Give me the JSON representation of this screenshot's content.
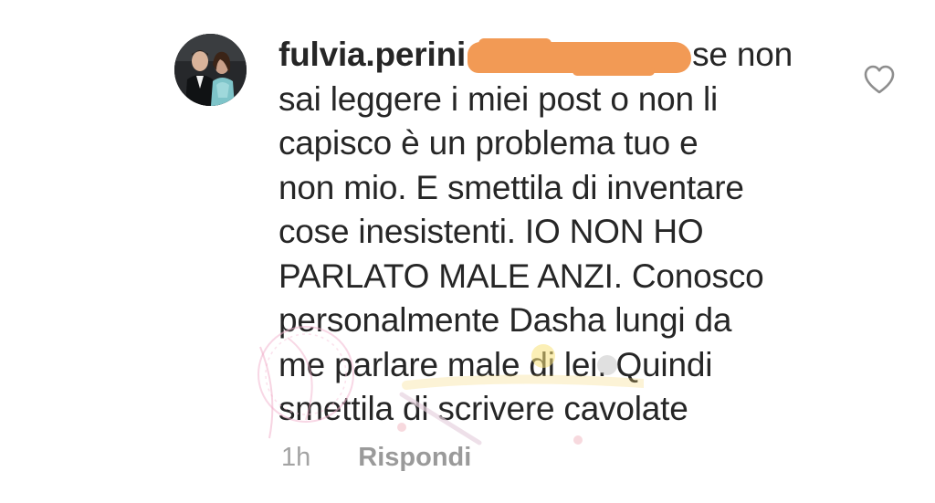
{
  "comment": {
    "username": "fulvia.perini",
    "lines": [
      "se non",
      "sai leggere i miei post o non li",
      "capisco è un problema tuo e",
      "non mio. E smettila di inventare",
      "cose inesistenti. IO NON HO",
      "PARLATO MALE ANZI. Conosco",
      "personalmente Dasha lungi da",
      "me parlare male di lei. Quindi",
      "smettila di scrivere cavolate"
    ],
    "timestamp": "1h",
    "reply_label": "Rispondi",
    "avatar_icon": "profile-photo",
    "like_icon": "heart-outline-icon",
    "redaction_color": "#f29a55"
  }
}
